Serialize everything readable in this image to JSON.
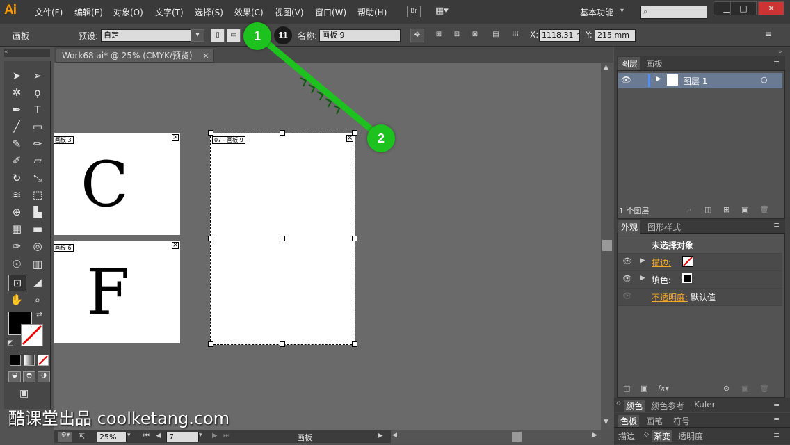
{
  "menubar": {
    "logo": "Ai",
    "items": [
      "文件(F)",
      "编辑(E)",
      "对象(O)",
      "文字(T)",
      "选择(S)",
      "效果(C)",
      "视图(V)",
      "窗口(W)",
      "帮助(H)"
    ],
    "bridge": "Br",
    "workspace": "基本功能"
  },
  "controlbar": {
    "tool_name": "画板",
    "preset_label": "预设:",
    "preset_value": "自定",
    "artboard_count": "11",
    "name_label": "名称:",
    "name_value": "画板 9",
    "x_label": "X:",
    "x_value": "1118.31 r",
    "y_label": "Y:",
    "y_value": "215 mm"
  },
  "document": {
    "tab_title": "Work68.ai* @ 25% (CMYK/预览)",
    "artboards": [
      {
        "label": "画板 3",
        "letter": "C"
      },
      {
        "label": "画板 6",
        "letter": "F"
      },
      {
        "label": "07 - 画板 9",
        "letter": ""
      }
    ]
  },
  "statusbar": {
    "zoom": "25%",
    "page": "7",
    "tool": "画板"
  },
  "layers_panel": {
    "tabs": [
      "图层",
      "画板"
    ],
    "layer_name": "图层 1",
    "footer": "1 个图层"
  },
  "appearance_panel": {
    "tabs": [
      "外观",
      "图形样式"
    ],
    "title": "未选择对象",
    "stroke_label": "描边:",
    "fill_label": "填色:",
    "opacity_label": "不透明度:",
    "opacity_value": "默认值"
  },
  "collapsed_panels": {
    "row1": [
      "颜色",
      "颜色参考",
      "Kuler"
    ],
    "row2": [
      "色板",
      "画笔",
      "符号"
    ],
    "row3": [
      "描边",
      "渐变",
      "透明度"
    ]
  },
  "annotation": {
    "step1": "1",
    "step2": "2",
    "accent": "#1ec21e"
  },
  "watermark": "酷课堂出品 coolketang.com"
}
